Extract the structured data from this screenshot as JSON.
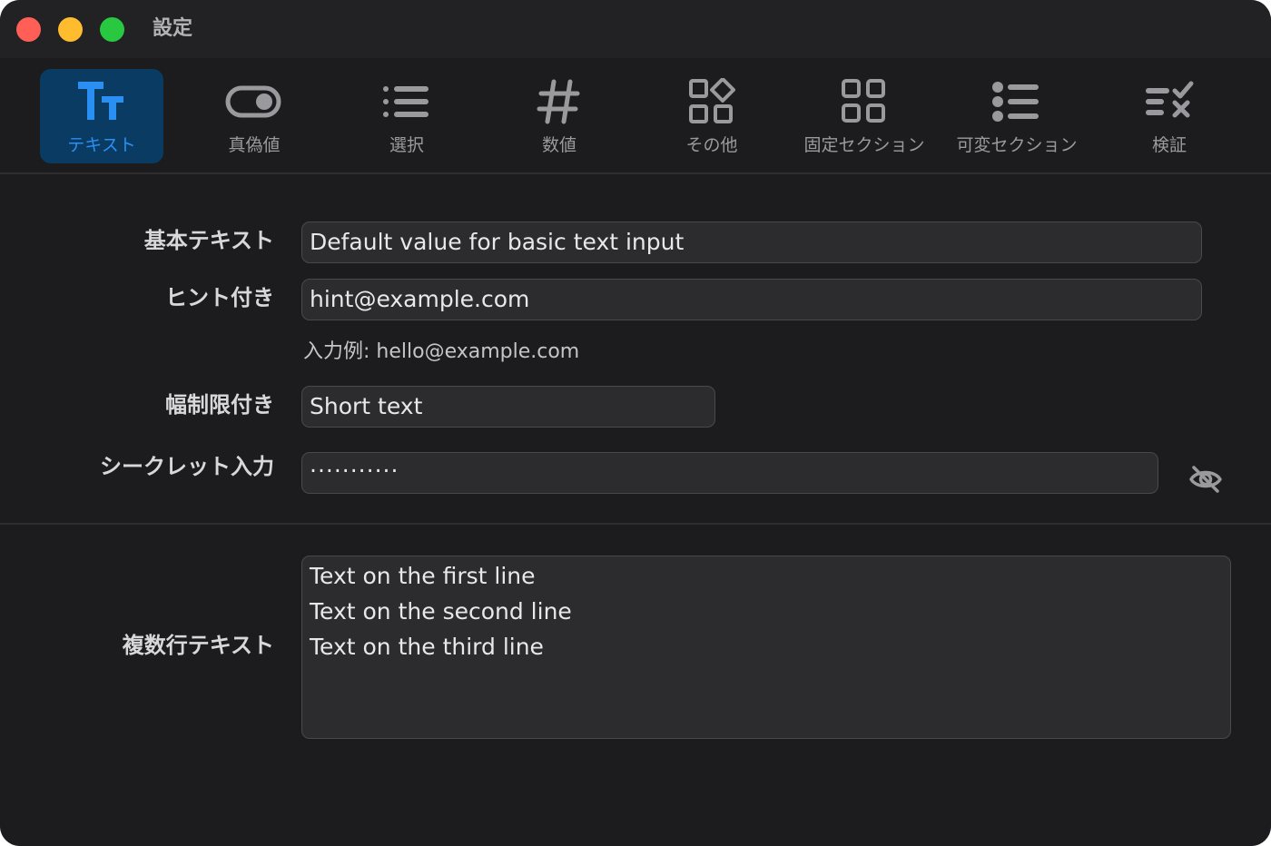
{
  "window": {
    "title": "設定"
  },
  "tabs": [
    {
      "label": "テキスト",
      "icon": "text-format-icon",
      "active": true
    },
    {
      "label": "真偽値",
      "icon": "toggle-icon",
      "active": false
    },
    {
      "label": "選択",
      "icon": "list-icon",
      "active": false
    },
    {
      "label": "数値",
      "icon": "number-sign-icon",
      "active": false
    },
    {
      "label": "その他",
      "icon": "shapes-grid-icon",
      "active": false
    },
    {
      "label": "固定セクション",
      "icon": "grid-icon",
      "active": false
    },
    {
      "label": "可変セクション",
      "icon": "bullet-list-icon",
      "active": false
    },
    {
      "label": "検証",
      "icon": "checklist-validate-icon",
      "active": false
    }
  ],
  "form": {
    "basic": {
      "label": "基本テキスト",
      "value": "Default value for basic text input"
    },
    "hinted": {
      "label": "ヒント付き",
      "value": "hint@example.com",
      "hint": "入力例: hello@example.com"
    },
    "limited": {
      "label": "幅制限付き",
      "value": "Short text"
    },
    "secret": {
      "label": "シークレット入力",
      "value": "···········",
      "toggle_icon": "eye-slash-icon"
    },
    "multiline": {
      "label": "複数行テキスト",
      "lines": [
        "Text on the first line",
        "Text on the second line",
        "Text on the third line"
      ]
    }
  },
  "colors": {
    "accent": "#2a8ff2",
    "active_tab_bg": "#0a3b63",
    "window_bg": "#1c1c1e",
    "field_bg": "#2c2c2e",
    "close": "#ff5f57",
    "minimize": "#febc2e",
    "maximize": "#28c840"
  }
}
